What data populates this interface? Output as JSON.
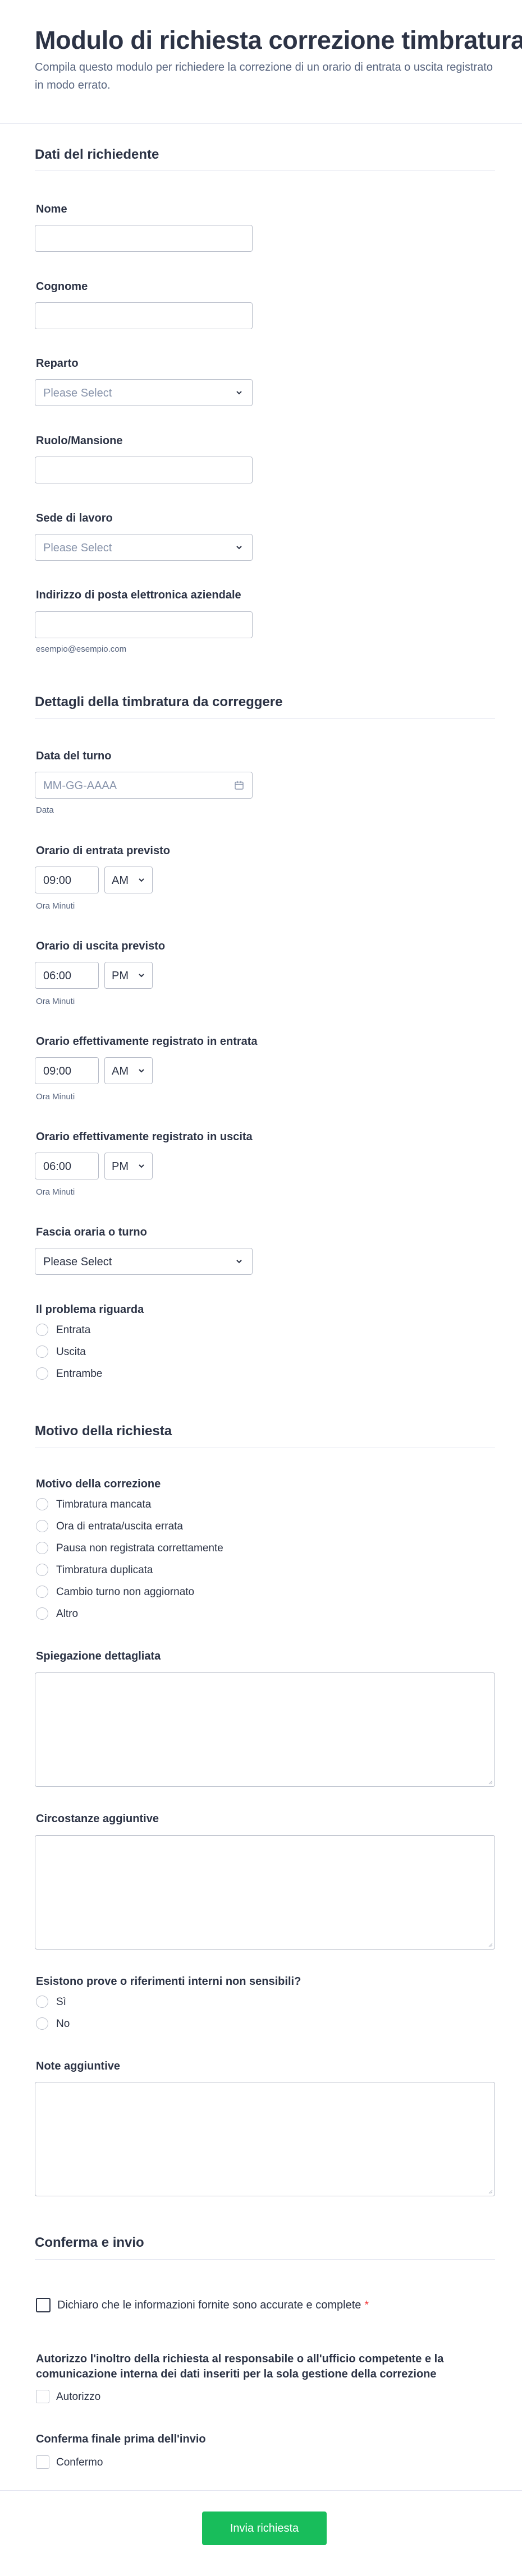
{
  "form": {
    "title": "Modulo di richiesta correzione timbratura",
    "subtitle": "Compila questo modulo per richiedere la correzione di un orario di entrata o uscita registrato in modo errato."
  },
  "section1": {
    "title": "Dati del richiedente",
    "nome_label": "Nome",
    "cognome_label": "Cognome",
    "reparto_label": "Reparto",
    "reparto_value": "Please Select",
    "ruolo_label": "Ruolo/Mansione",
    "sede_label": "Sede di lavoro",
    "sede_value": "Please Select",
    "email_label": "Indirizzo di posta elettronica aziendale",
    "email_sublabel": "esempio@esempio.com"
  },
  "section2": {
    "title": "Dettagli della timbratura da correggere",
    "data_label": "Data del turno",
    "data_placeholder": "MM-GG-AAAA",
    "data_sublabel": "Data",
    "entrata_prevista": {
      "label": "Orario di entrata previsto",
      "time": "09:00",
      "ampm": "AM",
      "sublabel": "Ora Minuti"
    },
    "uscita_prevista": {
      "label": "Orario di uscita previsto",
      "time": "06:00",
      "ampm": "PM",
      "sublabel": "Ora Minuti"
    },
    "entrata_effettiva": {
      "label": "Orario effettivamente registrato in entrata",
      "time": "09:00",
      "ampm": "AM",
      "sublabel": "Ora Minuti"
    },
    "uscita_effettiva": {
      "label": "Orario effettivamente registrato in uscita",
      "time": "06:00",
      "ampm": "PM",
      "sublabel": "Ora Minuti"
    },
    "fascia_label": "Fascia oraria o turno",
    "fascia_value": "Please Select",
    "problema_label": "Il problema riguarda",
    "problema_options": [
      "Entrata",
      "Uscita",
      "Entrambe"
    ]
  },
  "section3": {
    "title": "Motivo della richiesta",
    "motivo_label": "Motivo della correzione",
    "motivo_options": [
      "Timbratura mancata",
      "Ora di entrata/uscita errata",
      "Pausa non registrata correttamente",
      "Timbratura duplicata",
      "Cambio turno non aggiornato",
      "Altro"
    ],
    "spiegazione_label": "Spiegazione dettagliata",
    "circostanze_label": "Circostanze aggiuntive",
    "prove_label": "Esistono prove o riferimenti interni non sensibili?",
    "prove_options": [
      "Sì",
      "No"
    ],
    "note_label": "Note aggiuntive"
  },
  "section4": {
    "title": "Conferma e invio",
    "dichiaro_text": "Dichiaro che le informazioni fornite sono accurate e complete",
    "required_mark": "*",
    "autorizzo_label": "Autorizzo l'inoltro della richiesta al responsabile o all'ufficio competente e la comunicazione interna dei dati inseriti per la sola gestione della correzione",
    "autorizzo_option": "Autorizzo",
    "conferma_label": "Conferma finale prima dell'invio",
    "conferma_option": "Confermo"
  },
  "submit_label": "Invia richiesta",
  "colors": {
    "submit": "#18bd5b",
    "text": "#2c3345",
    "muted": "#57647e",
    "border": "#b8bdc9",
    "required": "#f23a3c"
  }
}
